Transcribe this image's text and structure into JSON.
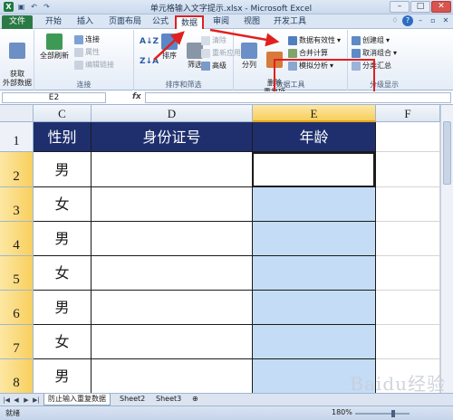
{
  "window": {
    "title": "单元格输入文字提示.xlsx - Microsoft Excel",
    "quick_access_icons": [
      "excel-logo-icon",
      "save-icon",
      "undo-icon",
      "redo-icon"
    ],
    "controls": [
      "minimize",
      "maximize",
      "close"
    ],
    "controls_glyphs": [
      "–",
      "□",
      "✕"
    ]
  },
  "tabs": [
    "文件",
    "开始",
    "插入",
    "页面布局",
    "公式",
    "数据",
    "审阅",
    "视图",
    "开发工具"
  ],
  "active_tab": "数据",
  "ribbon": {
    "get_external": "获取\n外部数据",
    "refresh_all": "全部刷新",
    "connections": "连接",
    "properties": "属性",
    "edit_links": "编辑链接",
    "group_connections": "连接",
    "sort": "排序",
    "filter": "筛选",
    "clear": "清除",
    "reapply": "重新应用",
    "advanced": "高级",
    "group_sort_filter": "排序和筛选",
    "text_to_columns": "分列",
    "remove_duplicates": "删除\n重复项",
    "data_validation": "数据有效性",
    "consolidate": "合并计算",
    "what_if": "模拟分析",
    "group_data_tools": "数据工具",
    "group_btn": "创建组",
    "ungroup_btn": "取消组合",
    "subtotal": "分类汇总",
    "group_outline": "分级显示"
  },
  "formula_bar": {
    "name_box": "E2",
    "fx": "fx",
    "value": ""
  },
  "sheet": {
    "columns": [
      "C",
      "D",
      "E",
      "F"
    ],
    "selected_column": "E",
    "rows": [
      "1",
      "2",
      "3",
      "4",
      "5",
      "6",
      "7",
      "8"
    ],
    "header_row": [
      "性别",
      "身份证号",
      "年龄"
    ],
    "gender_values": [
      "男",
      "女",
      "男",
      "女",
      "男",
      "女",
      "男"
    ],
    "active_cell": "E2",
    "highlight_color": "#c4dcf5",
    "header_fill": "#1f2f6e"
  },
  "sheet_tabs": [
    "防止输入重复数据",
    "Sheet2",
    "Sheet3"
  ],
  "status": {
    "ready": "就绪",
    "zoom": "180%"
  },
  "watermark": "Baidu经验"
}
